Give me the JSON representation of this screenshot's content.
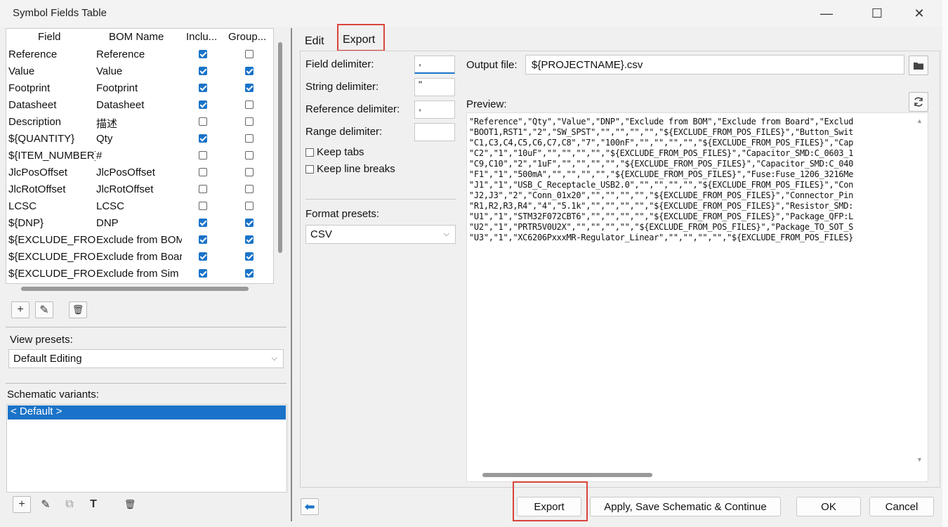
{
  "window": {
    "title": "Symbol Fields Table",
    "minimize": "—",
    "maximize": "☐",
    "close": "✕"
  },
  "fields_table": {
    "headers": {
      "field": "Field",
      "bom_name": "BOM Name",
      "include": "Inclu...",
      "group": "Group..."
    },
    "rows": [
      {
        "field": "Reference",
        "bom": "Reference",
        "include": true,
        "group": false
      },
      {
        "field": "Value",
        "bom": "Value",
        "include": true,
        "group": true
      },
      {
        "field": "Footprint",
        "bom": "Footprint",
        "include": true,
        "group": true
      },
      {
        "field": "Datasheet",
        "bom": "Datasheet",
        "include": true,
        "group": false
      },
      {
        "field": "Description",
        "bom": "描述",
        "include": false,
        "group": false
      },
      {
        "field": "${QUANTITY}",
        "bom": "Qty",
        "include": true,
        "group": false
      },
      {
        "field": "${ITEM_NUMBER}",
        "bom": "#",
        "include": false,
        "group": false
      },
      {
        "field": "JlcPosOffset",
        "bom": "JlcPosOffset",
        "include": false,
        "group": false
      },
      {
        "field": "JlcRotOffset",
        "bom": "JlcRotOffset",
        "include": false,
        "group": false
      },
      {
        "field": "LCSC",
        "bom": "LCSC",
        "include": false,
        "group": false
      },
      {
        "field": "${DNP}",
        "bom": "DNP",
        "include": true,
        "group": true
      },
      {
        "field": "${EXCLUDE_FROM_BOM}",
        "bom": "Exclude from BOM",
        "include": true,
        "group": true
      },
      {
        "field": "${EXCLUDE_FROM_BOARD}",
        "bom": "Exclude from Board",
        "include": true,
        "group": true
      },
      {
        "field": "${EXCLUDE_FROM_SIM}",
        "bom": "Exclude from Sim",
        "include": true,
        "group": true
      }
    ]
  },
  "left_toolbar": {
    "add": "+",
    "edit": "✎",
    "delete": "🗑"
  },
  "view_presets": {
    "label": "View presets:",
    "value": "Default Editing"
  },
  "schematic_variants": {
    "label": "Schematic variants:",
    "items": [
      "< Default >"
    ]
  },
  "variants_toolbar": {
    "add": "+",
    "edit": "✎",
    "copy": "⧉",
    "rename": "T",
    "delete": "🗑"
  },
  "tabs": [
    {
      "label": "Edit"
    },
    {
      "label": "Export"
    }
  ],
  "export": {
    "field_delimiter": {
      "label": "Field delimiter:",
      "value": ","
    },
    "string_delimiter": {
      "label": "String delimiter:",
      "value": "\""
    },
    "reference_delimiter": {
      "label": "Reference delimiter:",
      "value": ","
    },
    "range_delimiter": {
      "label": "Range delimiter:",
      "value": ""
    },
    "keep_tabs": "Keep tabs",
    "keep_line_breaks": "Keep line breaks",
    "format_presets": {
      "label": "Format presets:",
      "value": "CSV"
    },
    "output_file": {
      "label": "Output file:",
      "value": "${PROJECTNAME}.csv"
    },
    "preview_label": "Preview:",
    "preview_lines": [
      "\"Reference\",\"Qty\",\"Value\",\"DNP\",\"Exclude from BOM\",\"Exclude from Board\",\"Exclud",
      "\"BOOT1,RST1\",\"2\",\"SW_SPST\",\"\",\"\",\"\",\"\",\"${EXCLUDE_FROM_POS_FILES}\",\"Button_Swit",
      "\"C1,C3,C4,C5,C6,C7,C8\",\"7\",\"100nF\",\"\",\"\",\"\",\"\",\"${EXCLUDE_FROM_POS_FILES}\",\"Cap",
      "\"C2\",\"1\",\"10uF\",\"\",\"\",\"\",\"\",\"${EXCLUDE_FROM_POS_FILES}\",\"Capacitor_SMD:C_0603_1",
      "\"C9,C10\",\"2\",\"1uF\",\"\",\"\",\"\",\"\",\"${EXCLUDE_FROM_POS_FILES}\",\"Capacitor_SMD:C_040",
      "\"F1\",\"1\",\"500mA\",\"\",\"\",\"\",\"\",\"${EXCLUDE_FROM_POS_FILES}\",\"Fuse:Fuse_1206_3216Me",
      "\"J1\",\"1\",\"USB_C_Receptacle_USB2.0\",\"\",\"\",\"\",\"\",\"${EXCLUDE_FROM_POS_FILES}\",\"Con",
      "\"J2,J3\",\"2\",\"Conn_01x20\",\"\",\"\",\"\",\"\",\"${EXCLUDE_FROM_POS_FILES}\",\"Connector_Pin",
      "\"R1,R2,R3,R4\",\"4\",\"5.1k\",\"\",\"\",\"\",\"\",\"${EXCLUDE_FROM_POS_FILES}\",\"Resistor_SMD:",
      "\"U1\",\"1\",\"STM32F072CBT6\",\"\",\"\",\"\",\"\",\"${EXCLUDE_FROM_POS_FILES}\",\"Package_QFP:L",
      "\"U2\",\"1\",\"PRTR5V0U2X\",\"\",\"\",\"\",\"\",\"${EXCLUDE_FROM_POS_FILES}\",\"Package_TO_SOT_S",
      "\"U3\",\"1\",\"XC6206PxxxMR-Regulator_Linear\",\"\",\"\",\"\",\"\",\"${EXCLUDE_FROM_POS_FILES}"
    ]
  },
  "bottom_buttons": {
    "back": "⬅",
    "export": "Export",
    "apply": "Apply, Save Schematic & Continue",
    "ok": "OK",
    "cancel": "Cancel"
  }
}
